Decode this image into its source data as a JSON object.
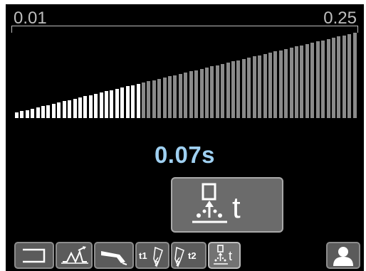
{
  "range": {
    "min_label": "0.01",
    "max_label": "0.25"
  },
  "level": {
    "bars_total": 65,
    "bars_lit": 24
  },
  "value": {
    "display": "0.07s"
  },
  "parameter": {
    "icon": "spot-timer-icon",
    "letter": "t"
  },
  "toolbar": {
    "buttons": [
      {
        "icon": "bracket-icon"
      },
      {
        "icon": "pulse-wave-icon"
      },
      {
        "icon": "torch-icon"
      },
      {
        "icon": "t1-torch-icon",
        "label": "t1"
      },
      {
        "icon": "t2-torch-icon",
        "label": "t2"
      },
      {
        "icon": "spot-timer-icon",
        "letter": "t"
      }
    ],
    "user_icon": "user-icon"
  },
  "colors": {
    "lit_bar": "#ffffff",
    "unlit_bar": "#8a8a8a",
    "value_text": "#9fd0f1"
  }
}
